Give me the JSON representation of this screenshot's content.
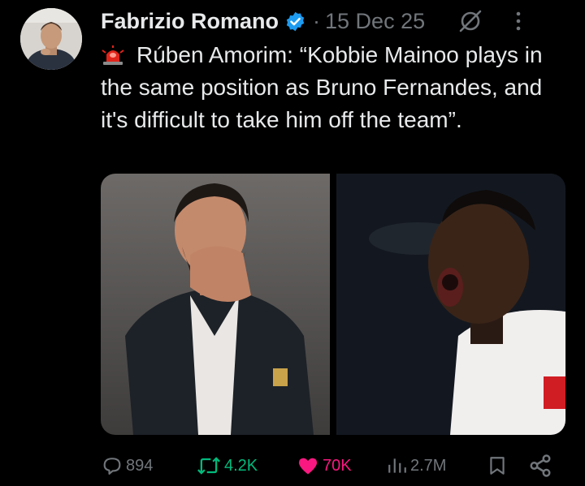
{
  "author": {
    "name": "Fabrizio Romano",
    "verified_color": "#1d9bf0",
    "separator": "·",
    "date": "15 Dec 25"
  },
  "tweet": {
    "emoji": "siren-icon",
    "text": "Rúben Amorim: “Kobbie Mainoo plays in the same position as Bruno Fernandes, and it's difficult to take him off the team”."
  },
  "metrics": {
    "replies": "894",
    "reposts": "4.2K",
    "likes": "70K",
    "views": "2.7M"
  },
  "colors": {
    "background": "#000000",
    "text": "#e7e9ea",
    "muted": "#71767b",
    "repost": "#00ba7c",
    "like": "#f91880"
  },
  "icons": [
    "verified-badge-icon",
    "grok-icon",
    "more-icon",
    "reply-icon",
    "repost-icon",
    "like-icon",
    "views-icon",
    "bookmark-icon",
    "share-icon"
  ]
}
